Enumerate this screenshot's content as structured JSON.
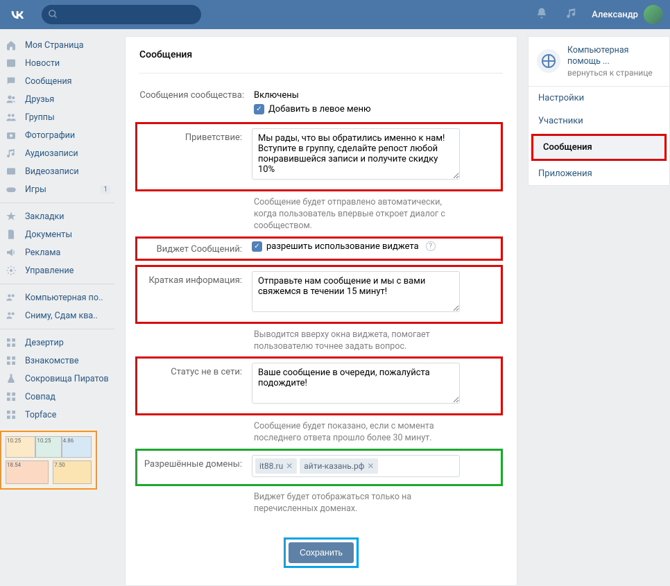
{
  "header": {
    "username": "Александр"
  },
  "leftnav": {
    "main": [
      {
        "icon": "home",
        "label": "Моя Страница"
      },
      {
        "icon": "news",
        "label": "Новости"
      },
      {
        "icon": "msg",
        "label": "Сообщения"
      },
      {
        "icon": "friends",
        "label": "Друзья"
      },
      {
        "icon": "groups",
        "label": "Группы"
      },
      {
        "icon": "photo",
        "label": "Фотографии"
      },
      {
        "icon": "audio",
        "label": "Аудиозаписи"
      },
      {
        "icon": "video",
        "label": "Видеозаписи"
      },
      {
        "icon": "games",
        "label": "Игры",
        "badge": "1"
      }
    ],
    "secondary": [
      {
        "icon": "star",
        "label": "Закладки"
      },
      {
        "icon": "docs",
        "label": "Документы"
      },
      {
        "icon": "ads",
        "label": "Реклама"
      },
      {
        "icon": "settings",
        "label": "Управление"
      }
    ],
    "community": [
      {
        "icon": "people",
        "label": "Компьютерная по.."
      },
      {
        "icon": "people",
        "label": "Сниму, Сдам ква.."
      }
    ],
    "apps": [
      {
        "icon": "app",
        "label": "Дезертир"
      },
      {
        "icon": "app",
        "label": "Взнакомстве"
      },
      {
        "icon": "flask",
        "label": "Сокровища Пиратов"
      },
      {
        "icon": "app",
        "label": "Совпад"
      },
      {
        "icon": "app",
        "label": "Topface"
      }
    ]
  },
  "content": {
    "title": "Сообщения",
    "rows": {
      "community_messages": {
        "label": "Сообщения сообщества:",
        "value": "Включены",
        "checkbox": "Добавить в левое меню"
      },
      "greeting": {
        "label": "Приветствие:",
        "value": "Мы рады, что вы обратились именно к нам! Вступите в группу, сделайте репост любой понравившейся записи и получите скидку 10%",
        "hint": "Сообщение будет отправлено автоматически, когда пользователь впервые откроет диалог с сообществом."
      },
      "widget": {
        "label": "Виджет Сообщений:",
        "checkbox": "разрешить использование виджета"
      },
      "brief": {
        "label": "Краткая информация:",
        "value": "Отправьте нам сообщение и мы с вами свяжемся в течении 15 минут!",
        "hint": "Выводится вверху окна виджета, помогает пользователю точнее задать вопрос."
      },
      "offline": {
        "label": "Статус не в сети:",
        "value": "Ваше сообщение в очереди, пожалуйста подождите!",
        "hint": "Сообщение будет показано, если с момента последнего ответа прошло более 30 минут."
      },
      "domains": {
        "label": "Разрешённые домены:",
        "tokens": [
          "it88.ru",
          "айти-казань.рф"
        ],
        "hint": "Виджет будет отображаться только на перечисленных доменах."
      }
    },
    "save": "Сохранить"
  },
  "rightcol": {
    "title": "Компьютерная помощь ...",
    "subtitle": "вернуться к странице",
    "menu": [
      {
        "label": "Настройки"
      },
      {
        "label": "Участники"
      },
      {
        "label": "Сообщения",
        "active": true,
        "highlight": true
      },
      {
        "label": "Приложения"
      }
    ]
  }
}
